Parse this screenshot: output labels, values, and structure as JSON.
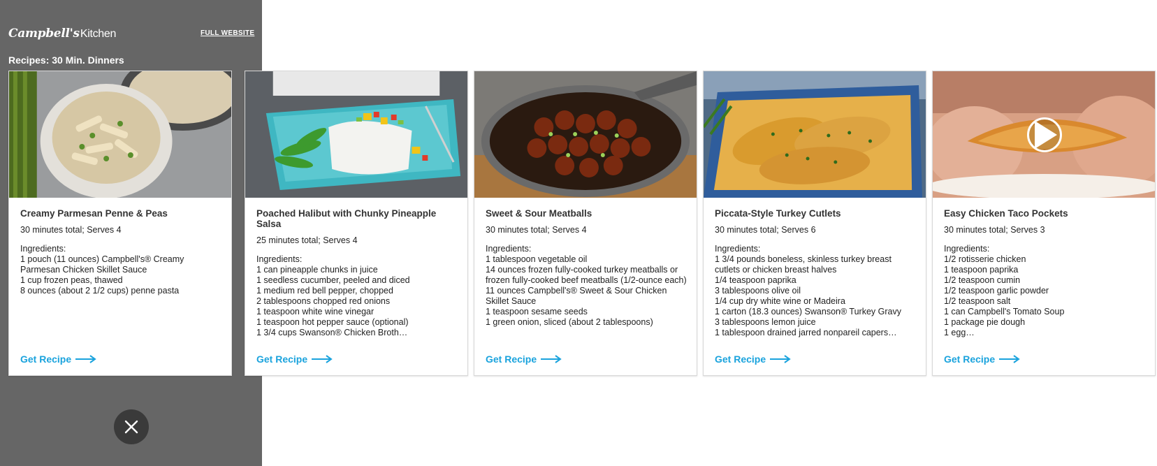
{
  "brand": {
    "script": "Campbell's",
    "word": "Kitchen"
  },
  "header": {
    "full_website": "FULL WEBSITE"
  },
  "section": {
    "title": "Recipes: 30 Min. Dinners"
  },
  "colors": {
    "panel": "#666666",
    "link": "#1aa3dd",
    "close_bg": "#3a3a3a"
  },
  "icons": {
    "close": "close-icon",
    "arrow": "arrow-right-icon",
    "play": "play-icon"
  },
  "cards": [
    {
      "title": "Creamy Parmesan Penne & Peas",
      "meta": "30 minutes total; Serves 4",
      "ingredients_label": "Ingredients:",
      "ingredients": [
        "1 pouch (11 ounces) Campbell's® Creamy Parmesan Chicken Skillet Sauce",
        "1 cup frozen peas, thawed",
        "8 ounces (about 2 1/2 cups) penne pasta"
      ],
      "cta": "Get Recipe"
    },
    {
      "title": "Poached Halibut with Chunky Pineapple Salsa",
      "meta": "25 minutes total; Serves 4",
      "ingredients_label": "Ingredients:",
      "ingredients": [
        "1 can pineapple chunks in juice",
        "1 seedless cucumber, peeled and diced",
        "1 medium red bell pepper, chopped",
        "2 tablespoons chopped red onions",
        "1 teaspoon white wine vinegar",
        "1 teaspoon hot pepper sauce (optional)",
        "1 3/4 cups Swanson® Chicken Broth…"
      ],
      "cta": "Get Recipe"
    },
    {
      "title": "Sweet & Sour Meatballs",
      "meta": "30 minutes total; Serves 4",
      "ingredients_label": "Ingredients:",
      "ingredients": [
        "1 tablespoon vegetable oil",
        "14 ounces frozen fully-cooked turkey meatballs or frozen fully-cooked beef meatballs (1/2-ounce each)",
        "11 ounces Campbell's® Sweet & Sour Chicken Skillet Sauce",
        "1 teaspoon sesame seeds",
        "1 green onion, sliced (about 2 tablespoons)"
      ],
      "cta": "Get Recipe"
    },
    {
      "title": "Piccata-Style Turkey Cutlets",
      "meta": "30 minutes total; Serves 6",
      "ingredients_label": "Ingredients:",
      "ingredients": [
        "1 3/4 pounds boneless, skinless turkey breast cutlets or chicken breast halves",
        "1/4 teaspoon paprika",
        "3 tablespoons olive oil",
        "1/4 cup dry white wine  or Madeira",
        "1 carton (18.3 ounces) Swanson® Turkey Gravy",
        "3 tablespoons lemon juice",
        "1 tablespoon drained jarred nonpareil capers…"
      ],
      "cta": "Get Recipe"
    },
    {
      "title": "Easy Chicken Taco Pockets",
      "meta": "30 minutes total; Serves 3",
      "ingredients_label": "Ingredients:",
      "ingredients": [
        "1/2 rotisserie chicken",
        "1 teaspoon paprika",
        "1/2 teaspoon cumin",
        "1/2 teaspoon garlic powder",
        "1/2 teaspoon salt",
        "1 can Campbell's Tomato Soup",
        "1 package pie dough",
        "1 egg…"
      ],
      "cta": "Get Recipe"
    }
  ]
}
